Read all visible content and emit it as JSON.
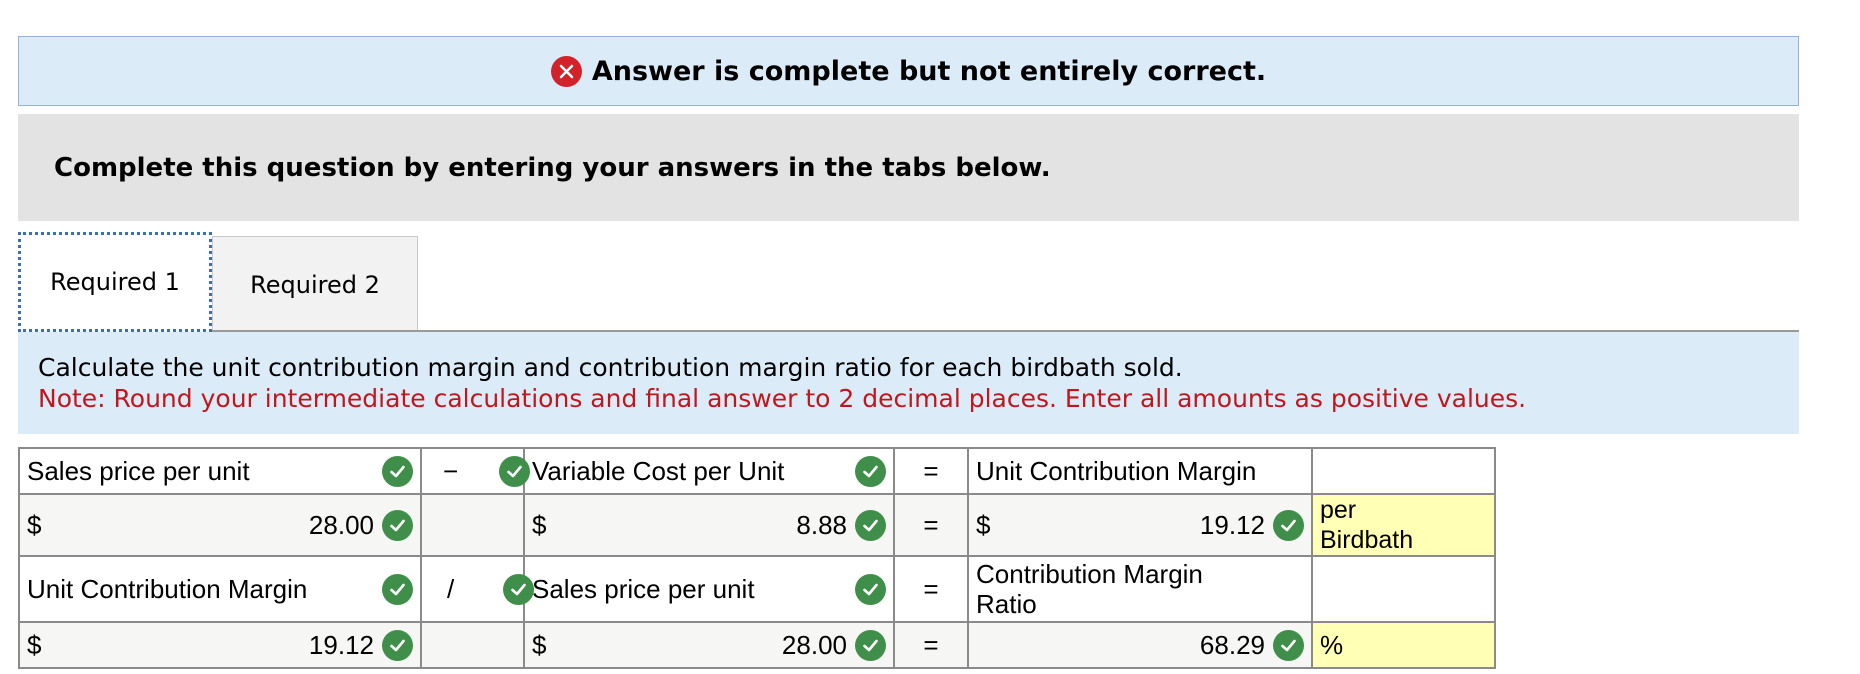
{
  "banner": {
    "text": "Answer is complete but not entirely correct.",
    "icon": "error-x-icon",
    "icon_color": "#d3232a"
  },
  "instructions": "Complete this question by entering your answers in the tabs below.",
  "tabs": [
    {
      "label": "Required 1",
      "active": true
    },
    {
      "label": "Required 2",
      "active": false
    }
  ],
  "question": {
    "text": "Calculate the unit contribution margin and contribution margin ratio for each birdbath sold.",
    "note": "Note: Round your intermediate calculations and final answer to 2 decimal places. Enter all amounts as positive values."
  },
  "table": {
    "row1": {
      "label1": "Sales price per unit",
      "op": "−",
      "label2": "Variable Cost per Unit",
      "eq": "=",
      "result_label": "Unit Contribution Margin",
      "unit_label": ""
    },
    "row2": {
      "cur1": "$",
      "value1": "28.00",
      "cur2": "$",
      "value2": "8.88",
      "eq": "=",
      "cur3": "$",
      "result": "19.12",
      "unit": "per Birdbath"
    },
    "row3": {
      "label1": "Unit Contribution Margin",
      "op": "/",
      "label2": "Sales price per unit",
      "eq": "=",
      "result_label": "Contribution Margin Ratio",
      "unit_label": ""
    },
    "row4": {
      "cur1": "$",
      "value1": "19.12",
      "cur2": "$",
      "value2": "28.00",
      "eq": "=",
      "result": "68.29",
      "unit": "%"
    }
  },
  "colors": {
    "check_green": "#3f8f4a",
    "note_red": "#c0161c",
    "banner_bg": "#dcebf8",
    "unit_yellow": "#ffffb5"
  }
}
